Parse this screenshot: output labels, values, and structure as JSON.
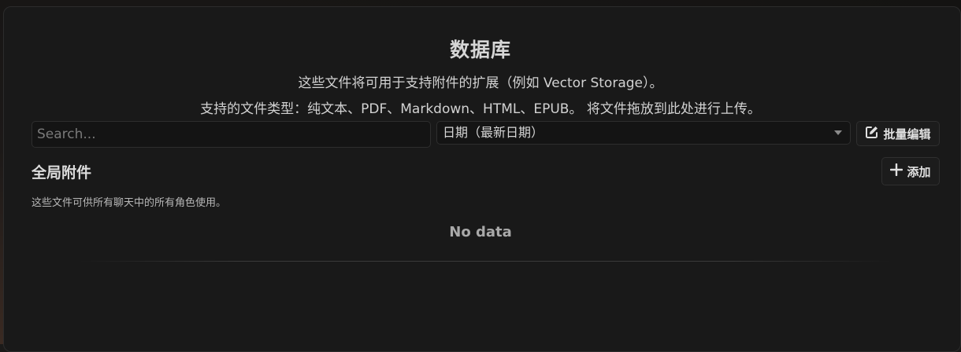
{
  "header": {
    "title": "数据库",
    "description": "这些文件将可用于支持附件的扩展（例如 Vector Storage）。",
    "supported_types": "支持的文件类型：纯文本、PDF、Markdown、HTML、EPUB。 将文件拖放到此处进行上传。"
  },
  "toolbar": {
    "search_placeholder": "Search...",
    "search_value": "",
    "sort_selected": "日期（最新日期）",
    "bulk_edit_label": "批量编辑"
  },
  "global_attachments": {
    "title": "全局附件",
    "description": "这些文件可供所有聊天中的所有角色使用。",
    "add_label": "添加",
    "empty_text": "No data"
  },
  "icons": {
    "bulk_edit": "edit-icon",
    "add": "plus-icon",
    "sort": "chevron-down-icon"
  }
}
